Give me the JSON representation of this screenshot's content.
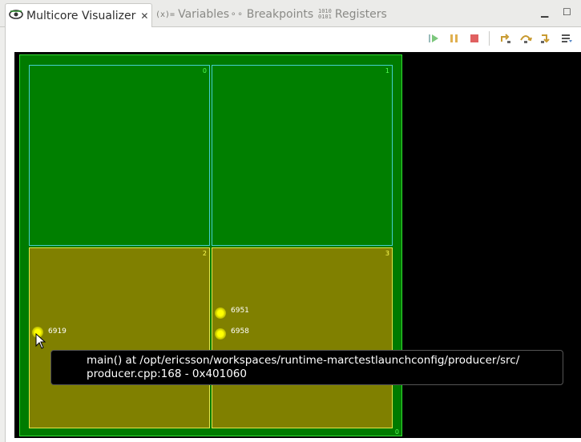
{
  "tabs": [
    {
      "label": "Multicore Visualizer",
      "icon": "visualizer-icon",
      "active": true
    },
    {
      "label": "Variables",
      "icon": "variables-icon",
      "glyph": "(x)="
    },
    {
      "label": "Breakpoints",
      "icon": "breakpoints-icon",
      "glyph": "⚬⚬"
    },
    {
      "label": "Registers",
      "icon": "registers-icon",
      "glyph": "1010\n0101"
    }
  ],
  "toolbar": [
    "resume-icon",
    "suspend-icon",
    "terminate-icon",
    "step-into-icon",
    "step-over-icon",
    "step-return-icon",
    "view-menu-icon"
  ],
  "cpu": {
    "id": "0",
    "cores": [
      {
        "id": "0",
        "state": "running"
      },
      {
        "id": "1",
        "state": "running"
      },
      {
        "id": "2",
        "state": "suspended",
        "threads": [
          "6919"
        ]
      },
      {
        "id": "3",
        "state": "suspended",
        "threads": [
          "6951",
          "6958"
        ]
      }
    ]
  },
  "tooltip": {
    "line1": "main() at /opt/ericsson/workspaces/runtime-marctestlaunchconfig/producer/src/",
    "line2": "producer.cpp:168 - 0x401060"
  },
  "colors": {
    "running": "#007f00",
    "suspended": "#808000",
    "thread": "#ffff00",
    "background": "#000000"
  }
}
